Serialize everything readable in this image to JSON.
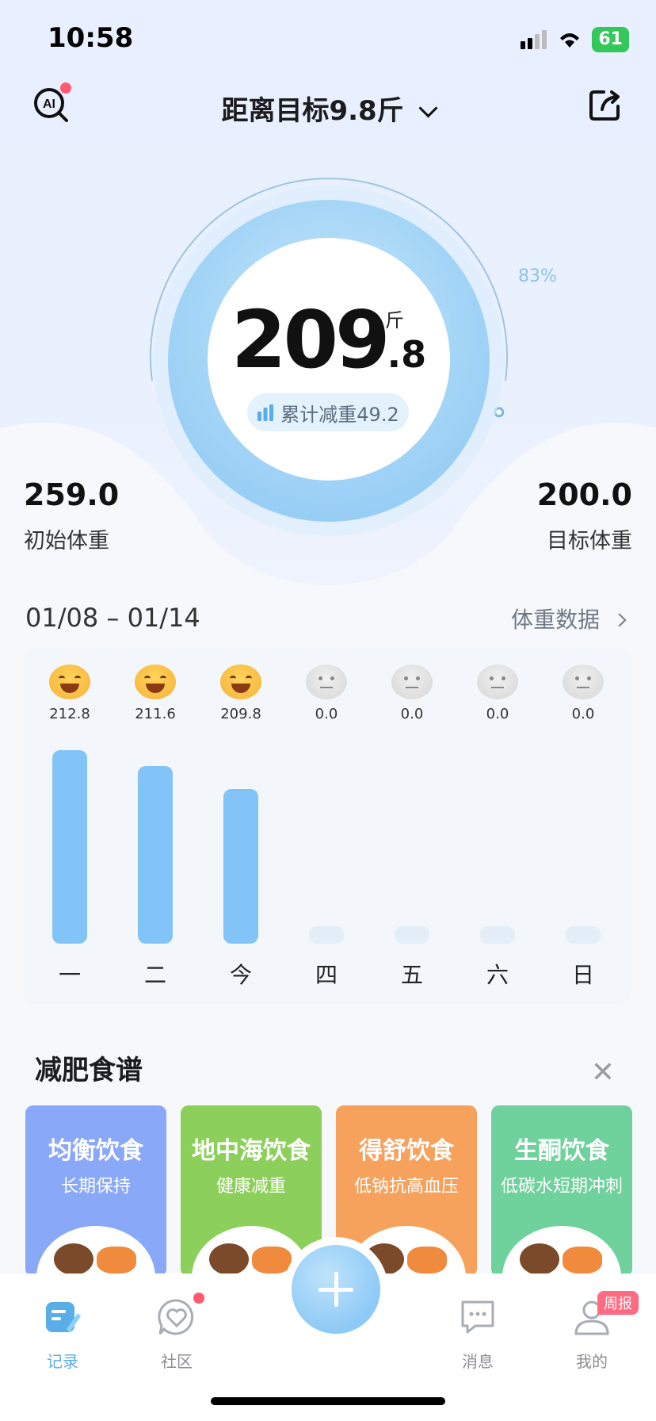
{
  "status_bar": {
    "time": "10:58",
    "battery": "61"
  },
  "header": {
    "title": "距离目标9.8斤"
  },
  "progress": {
    "percent_label": "83%",
    "percent": 0.83
  },
  "weight": {
    "main": "209",
    "decimal": ".8",
    "unit": "斤"
  },
  "cumulative": {
    "label": "累计减重49.2"
  },
  "initial_weight": {
    "value": "259.0",
    "label": "初始体重"
  },
  "target_weight": {
    "value": "200.0",
    "label": "目标体重"
  },
  "weekly": {
    "date_range": "01/08 – 01/14",
    "link_label": "体重数据",
    "days": [
      {
        "label": "一",
        "value": "212.8",
        "mood": "laugh-cry-icon"
      },
      {
        "label": "二",
        "value": "211.6",
        "mood": "smile-icon"
      },
      {
        "label": "今",
        "value": "209.8",
        "mood": "smile-icon"
      },
      {
        "label": "四",
        "value": "0.0",
        "mood": "neutral-icon"
      },
      {
        "label": "五",
        "value": "0.0",
        "mood": "neutral-icon"
      },
      {
        "label": "六",
        "value": "0.0",
        "mood": "neutral-icon"
      },
      {
        "label": "日",
        "value": "0.0",
        "mood": "neutral-icon"
      }
    ]
  },
  "recipes": {
    "title": "减肥食谱",
    "items": [
      {
        "title": "均衡饮食",
        "subtitle": "长期保持",
        "color": "#8aa8f8"
      },
      {
        "title": "地中海饮食",
        "subtitle": "健康减重",
        "color": "#8ccf5a"
      },
      {
        "title": "得舒饮食",
        "subtitle": "低钠抗高血压",
        "color": "#f6a15c"
      },
      {
        "title": "生酮饮食",
        "subtitle": "低碳水短期冲刺",
        "color": "#6fd19b"
      }
    ]
  },
  "tabs": {
    "record": "记录",
    "community": "社区",
    "messages": "消息",
    "mine": "我的",
    "badge": "周报"
  }
}
